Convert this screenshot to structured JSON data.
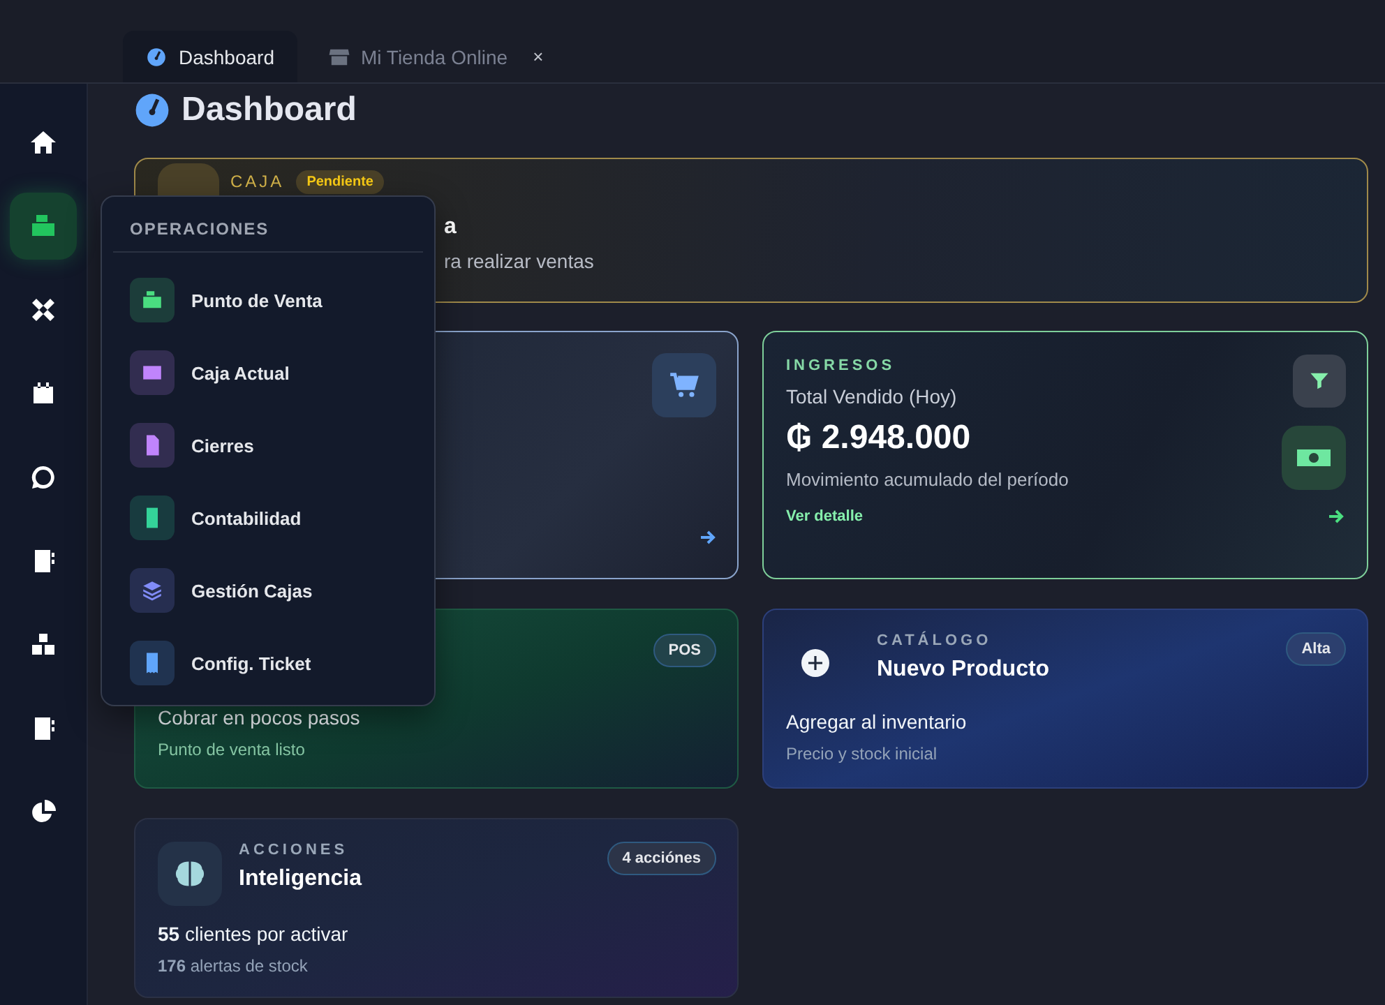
{
  "tabs": [
    {
      "label": "Dashboard",
      "selected": true,
      "closable": false
    },
    {
      "label": "Mi Tienda Online",
      "selected": false,
      "closable": true,
      "close": "×"
    }
  ],
  "sidebar": {
    "items": [
      {
        "selected": false
      },
      {
        "selected": true
      },
      {
        "selected": false
      },
      {
        "selected": false
      },
      {
        "selected": false
      },
      {
        "selected": false
      },
      {
        "selected": false
      },
      {
        "selected": false
      },
      {
        "selected": false
      }
    ]
  },
  "page_title": "Dashboard",
  "caja_card": {
    "label": "CAJA",
    "badge": "Pendiente",
    "title": "a",
    "subtitle": "ra realizar ventas"
  },
  "ingresos_card": {
    "label": "INGRESOS",
    "title": "Total Vendido (Hoy)",
    "value": "₲ 2.948.000",
    "caption": "Movimiento acumulado del período",
    "link": "Ver detalle"
  },
  "pos_card": {
    "badge": "POS",
    "text": "Cobrar en pocos pasos",
    "subtext": "Punto de venta listo"
  },
  "catalogo_card": {
    "label": "CATÁLOGO",
    "title": "Nuevo Producto",
    "badge": "Alta",
    "text": "Agregar al inventario",
    "subtext": "Precio y stock inicial"
  },
  "acciones_card": {
    "label": "ACCIONES",
    "title": "Inteligencia",
    "badge": "4 acciónes",
    "text": "**55** clientes por activar",
    "subtext": "**176** alertas de stock"
  },
  "menu": {
    "title": "OPERACIONES",
    "items": [
      {
        "label": "Punto de Venta",
        "color": "#4ade80"
      },
      {
        "label": "Caja Actual",
        "color": "#c084fc"
      },
      {
        "label": "Cierres",
        "color": "#c084fc"
      },
      {
        "label": "Contabilidad",
        "color": "#34d399"
      },
      {
        "label": "Gestión Cajas",
        "color": "#818cf8"
      },
      {
        "label": "Config. Ticket",
        "color": "#60a5fa"
      }
    ]
  }
}
